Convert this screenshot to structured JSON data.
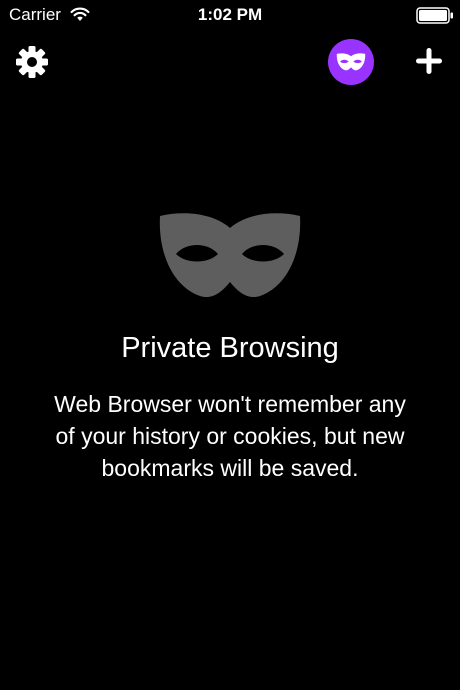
{
  "status_bar": {
    "carrier": "Carrier",
    "time": "1:02 PM",
    "icons": [
      "wifi-icon",
      "battery-icon"
    ]
  },
  "toolbar": {
    "settings_icon": "gear-icon",
    "private_icon": "mask-icon",
    "new_tab_icon": "plus-icon",
    "accent_color": "#9933ff"
  },
  "empty_state": {
    "icon": "mask-icon",
    "title": "Private Browsing",
    "message": "Web Browser won't remember any of your history or cookies, but new bookmarks will be saved."
  },
  "colors": {
    "background": "#000000",
    "text": "#ffffff",
    "mask": "#5e5e5e"
  }
}
